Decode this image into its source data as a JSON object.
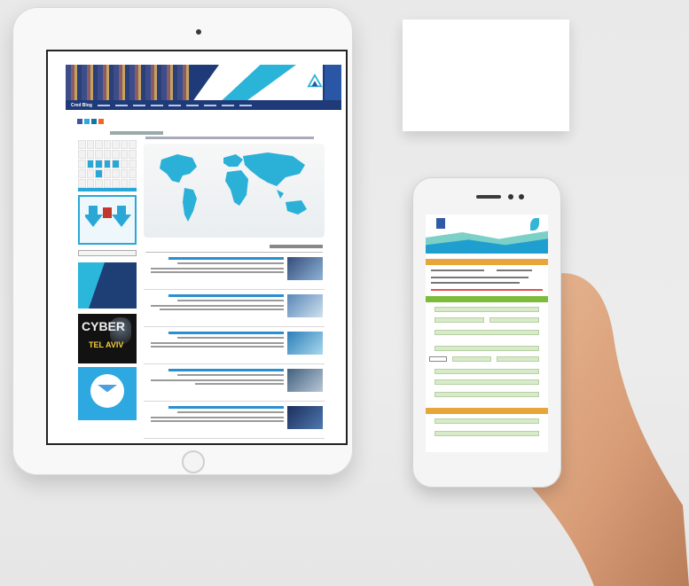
{
  "scene": {
    "description_tags": [
      "tablet-device",
      "smartphone-device",
      "blank-business-card",
      "hand"
    ]
  },
  "tablet": {
    "nav_label": "Cred Blog",
    "ad_text_1": "CYBER",
    "ad_text_2": "TEL AVIV",
    "colors": {
      "accent": "#29a8d8",
      "nav": "#1f3a78",
      "link": "#2a8fd0"
    }
  },
  "phone": {
    "colors": {
      "header_bar": "#e8a63a",
      "form_bar": "#7cbc3a",
      "field": "#d7ebc8"
    }
  }
}
